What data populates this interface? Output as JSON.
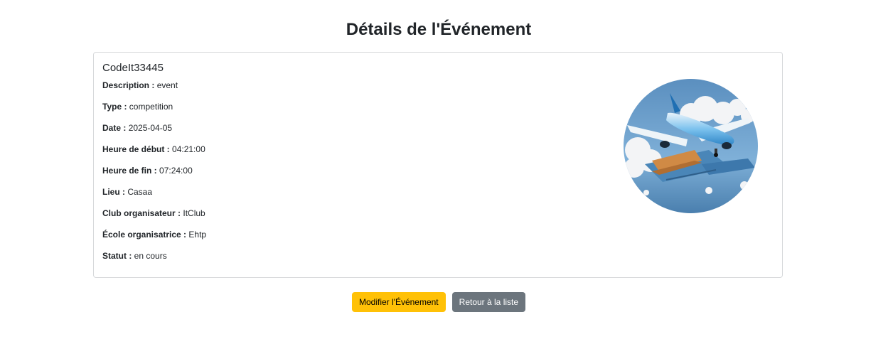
{
  "page": {
    "title": "Détails de l'Événement"
  },
  "event": {
    "name": "CodeIt33445",
    "image_description": "airplane-over-passports-illustration",
    "fields": [
      {
        "label": "Description :",
        "value": "event"
      },
      {
        "label": "Type :",
        "value": "competition"
      },
      {
        "label": "Date :",
        "value": "2025-04-05"
      },
      {
        "label": "Heure de début :",
        "value": "04:21:00"
      },
      {
        "label": "Heure de fin :",
        "value": "07:24:00"
      },
      {
        "label": "Lieu :",
        "value": "Casaa"
      },
      {
        "label": "Club organisateur :",
        "value": "ItClub"
      },
      {
        "label": "École organisatrice :",
        "value": "Ehtp"
      },
      {
        "label": "Statut :",
        "value": "en cours"
      }
    ]
  },
  "actions": {
    "edit_label": "Modifier l'Événement",
    "back_label": "Retour à la liste"
  },
  "colors": {
    "edit_button": "#ffc107",
    "back_button": "#6c757d",
    "card_border": "#d7d9db"
  }
}
